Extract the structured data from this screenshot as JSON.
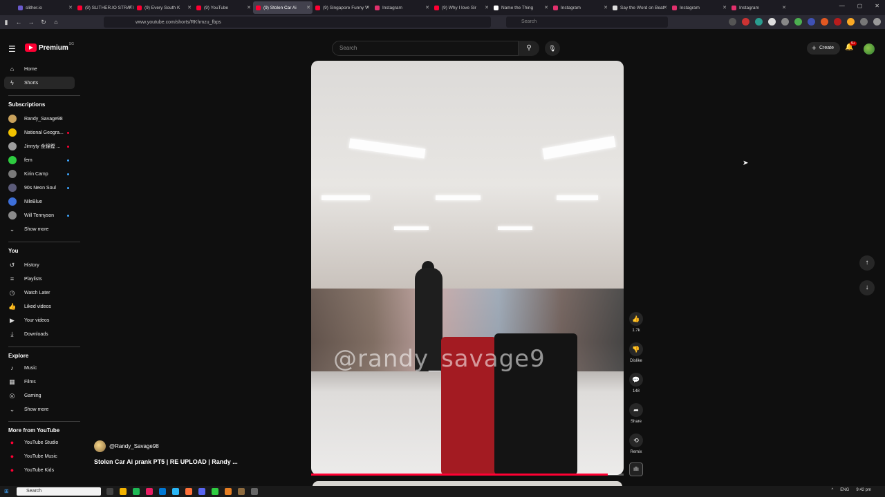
{
  "browser": {
    "tabs": [
      {
        "title": "slither.io",
        "color": "#6a5acd"
      },
      {
        "title": "(9) SLITHER.IO STRATI",
        "color": "#ff0033"
      },
      {
        "title": "(9) Every South K",
        "color": "#ff0033"
      },
      {
        "title": "(9) YouTube",
        "color": "#ff0033"
      },
      {
        "title": "(9) Stolen Car Ai",
        "color": "#ff0033"
      },
      {
        "title": "(9) Singapore Funny V",
        "color": "#ff0033"
      },
      {
        "title": "Instagram",
        "color": "#e1306c"
      },
      {
        "title": "(9) Why I love Sir",
        "color": "#ff0033"
      },
      {
        "title": "Name the Thing",
        "color": "#ffffff"
      },
      {
        "title": "Instagram",
        "color": "#e1306c"
      },
      {
        "title": "Say the Word on Beat",
        "color": "#dddddd"
      },
      {
        "title": "Instagram",
        "color": "#e1306c"
      },
      {
        "title": "Instagram",
        "color": "#e1306c"
      }
    ],
    "active_tab_index": 4,
    "url": "www.youtube.com/shorts/RKhmzu_fbps",
    "search_placeholder": "Search"
  },
  "header": {
    "logo_text": "Premium",
    "logo_country": "SG",
    "search_placeholder": "Search",
    "create_label": "Create",
    "notifications_badge": "9+"
  },
  "sidebar": {
    "main": [
      {
        "label": "Home",
        "icon": "home-icon"
      },
      {
        "label": "Shorts",
        "icon": "shorts-icon",
        "active": true
      }
    ],
    "subscriptions_title": "Subscriptions",
    "subscriptions": [
      {
        "label": "Randy_Savage98",
        "color": "#c9a25c",
        "dot": ""
      },
      {
        "label": "National Geogra...",
        "color": "#f2c200",
        "dot": "red"
      },
      {
        "label": "Jinnyty 金鐘鏗 ...",
        "color": "#9e9e9e",
        "dot": "red"
      },
      {
        "label": "fem",
        "color": "#2ecc40",
        "dot": "blue"
      },
      {
        "label": "Kirin Camp",
        "color": "#7a7a7a",
        "dot": "blue"
      },
      {
        "label": "90s Neon Soul",
        "color": "#5c5c7a",
        "dot": "blue"
      },
      {
        "label": "NileBlue",
        "color": "#3d6fd9",
        "dot": ""
      },
      {
        "label": "Will Tennyson",
        "color": "#8a8a8a",
        "dot": "blue"
      }
    ],
    "show_more": "Show more",
    "you_title": "You",
    "you": [
      {
        "label": "History",
        "icon": "history-icon"
      },
      {
        "label": "Playlists",
        "icon": "playlists-icon"
      },
      {
        "label": "Watch Later",
        "icon": "clock-icon"
      },
      {
        "label": "Liked videos",
        "icon": "thumbs-up-icon"
      },
      {
        "label": "Your videos",
        "icon": "video-icon"
      },
      {
        "label": "Downloads",
        "icon": "download-icon"
      }
    ],
    "explore_title": "Explore",
    "explore": [
      {
        "label": "Music",
        "icon": "music-icon"
      },
      {
        "label": "Films",
        "icon": "film-icon"
      },
      {
        "label": "Gaming",
        "icon": "gaming-icon"
      }
    ],
    "show_more_2": "Show more",
    "more_title": "More from YouTube",
    "more": [
      {
        "label": "YouTube Studio",
        "icon": "youtube-studio-icon"
      },
      {
        "label": "YouTube Music",
        "icon": "youtube-music-icon"
      },
      {
        "label": "YouTube Kids",
        "icon": "youtube-kids-icon"
      }
    ]
  },
  "short": {
    "channel": "@Randy_Savage98",
    "title": "Stolen Car Ai prank PT5 | RE UPLOAD | Randy ...",
    "watermark": "@randy_savage9",
    "progress": 0.95,
    "likes": "1.7k",
    "dislike_label": "Dislike",
    "comments": "148",
    "share_label": "Share",
    "remix_label": "Remix"
  },
  "taskbar": {
    "search_placeholder": "Search",
    "lang": "ENG",
    "time": "9:42 pm"
  }
}
